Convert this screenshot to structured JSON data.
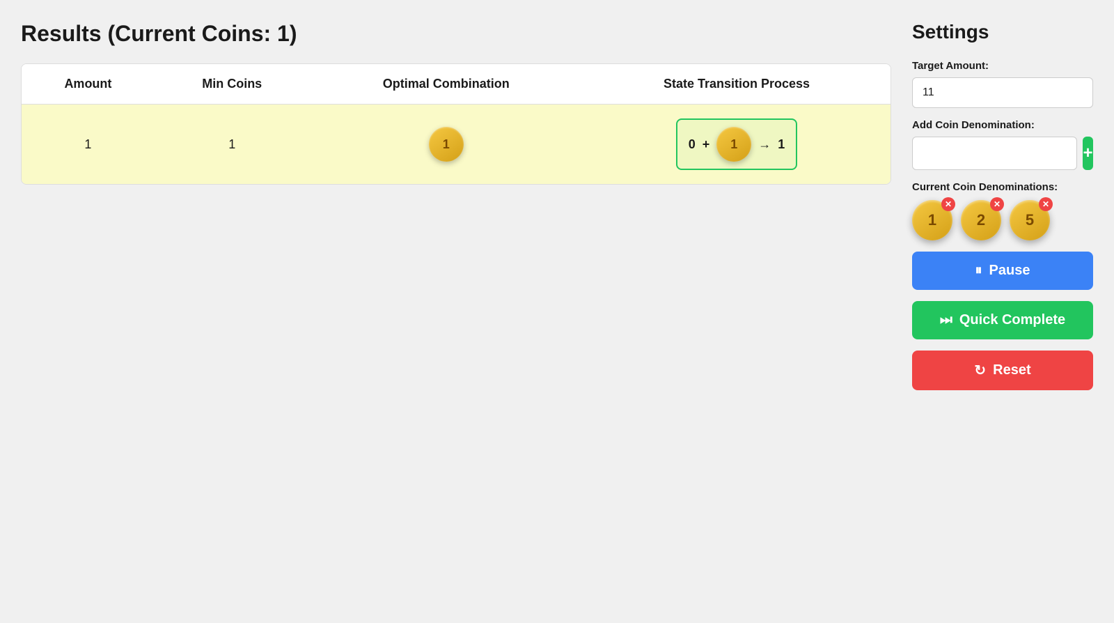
{
  "page": {
    "title": "Results (Current Coins: 1)"
  },
  "table": {
    "headers": [
      "Amount",
      "Min Coins",
      "Optimal Combination",
      "State Transition Process"
    ],
    "rows": [
      {
        "amount": "1",
        "min_coins": "1",
        "coin_value": "1",
        "transition_zero": "0",
        "transition_plus": "+",
        "transition_coin": "1",
        "transition_arrow": "→",
        "transition_result": "1"
      }
    ]
  },
  "settings": {
    "title": "Settings",
    "target_amount_label": "Target Amount:",
    "target_amount_value": "11",
    "add_denom_label": "Add Coin Denomination:",
    "add_btn_label": "+",
    "current_denoms_label": "Current Coin Denominations:",
    "denominations": [
      "1",
      "2",
      "5"
    ],
    "pause_label": "Pause",
    "quick_complete_label": "Quick Complete",
    "reset_label": "Reset"
  }
}
